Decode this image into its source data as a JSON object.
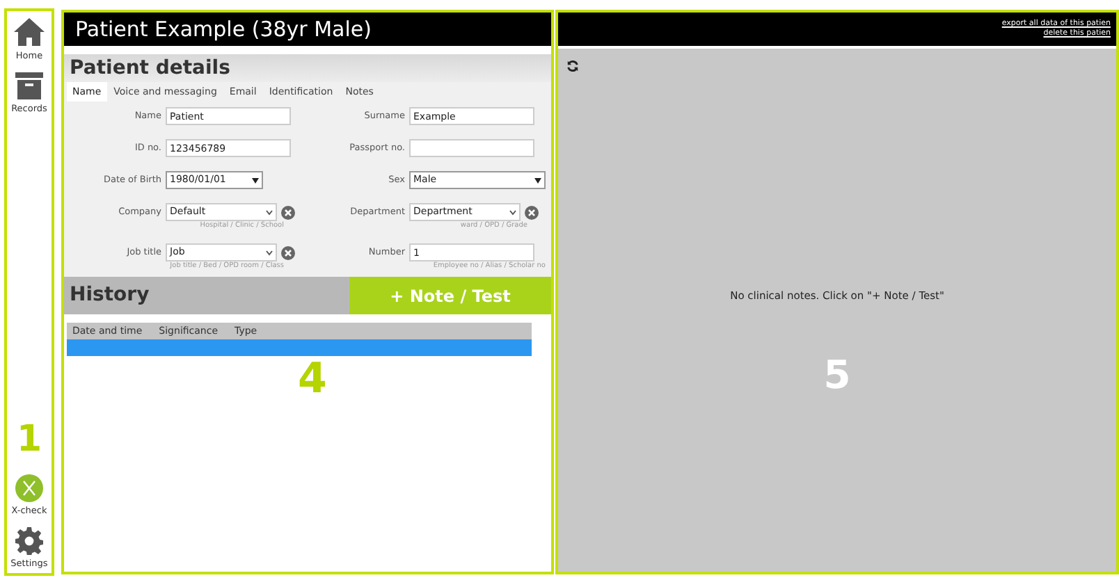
{
  "sidebar": {
    "items": [
      {
        "label": "Home",
        "kind": "home"
      },
      {
        "label": "Records",
        "kind": "records"
      }
    ],
    "bottom_items": [
      {
        "label": "X-check",
        "kind": "xcheck"
      },
      {
        "label": "Settings",
        "kind": "settings"
      }
    ]
  },
  "annotations": [
    "1",
    "4",
    "5"
  ],
  "patient_header": {
    "title": "Patient Example (38yr Male)"
  },
  "details": {
    "title": "Patient details",
    "tabs": [
      {
        "label": "Name",
        "selected": true
      },
      {
        "label": "Voice and messaging",
        "selected": false
      },
      {
        "label": "Email",
        "selected": false
      },
      {
        "label": "Identification",
        "selected": false
      },
      {
        "label": "Notes",
        "selected": false
      }
    ],
    "fields": [
      {
        "label": "Name",
        "value": "Patient",
        "kind": "text"
      },
      {
        "label": "Surname",
        "value": "Example",
        "kind": "text"
      },
      {
        "label": "ID no.",
        "value": "123456789",
        "kind": "text"
      },
      {
        "label": "Passport no.",
        "kind": "text"
      },
      {
        "label": "Date of Birth",
        "value": "1980/01/01",
        "kind": "date"
      },
      {
        "label": "Sex",
        "value": "Male",
        "kind": "select"
      },
      {
        "label": "Company",
        "value": "Default",
        "kind": "combo",
        "hint": "Hospital / Clinic / School"
      },
      {
        "label": "Department",
        "value": "Department",
        "kind": "combo",
        "hint": "ward / OPD / Grade"
      },
      {
        "label": "Job title",
        "value": "Job",
        "kind": "combo",
        "hint": "Job title / Bed / OPD room / Class"
      },
      {
        "label": "Number",
        "value": "1",
        "kind": "text",
        "hint": "Employee no / Alias / Scholar no"
      }
    ]
  },
  "history": {
    "title": "History",
    "add_button": "+ Note / Test",
    "columns": [
      "Date and time",
      "Significance",
      "Type"
    ],
    "rows": [
      {
        "selected": true
      }
    ]
  },
  "notes_panel": {
    "links": [
      "export all data of this patien",
      "delete this patien"
    ],
    "empty_message": "No clinical notes. Click on \"+ Note / Test\""
  }
}
